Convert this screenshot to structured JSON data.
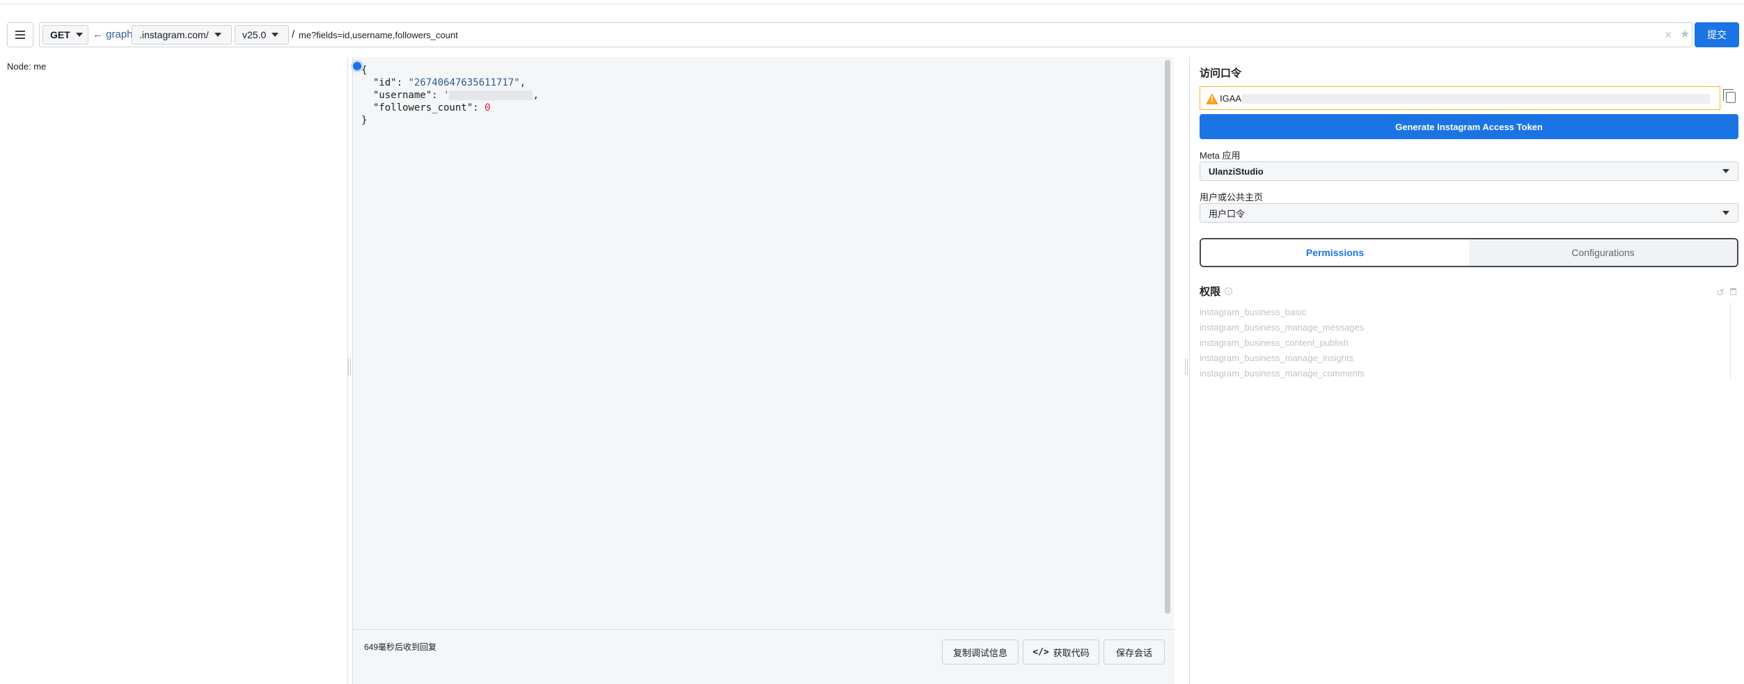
{
  "toolbar": {
    "method": "GET",
    "graph_link": "← graph.",
    "domain": ".instagram.com/",
    "version": "v25.0",
    "slash": "/",
    "path": "me?fields=id,username,followers_count",
    "clear_label": "×",
    "star_label": "★",
    "submit_label": "提交"
  },
  "left": {
    "node_label": "Node: me"
  },
  "response": {
    "open_brace": "{",
    "id_key": "\"id\"",
    "id_value": "\"26740647635611717\"",
    "username_key": "\"username\"",
    "username_value_start": "'",
    "followers_key": "\"followers_count\"",
    "followers_value": "0",
    "close_brace": "}"
  },
  "footer": {
    "status": "649毫秒后收到回复",
    "copy_debug_label": "复制调试信息",
    "get_code_glyph": "</>",
    "get_code_label": "获取代码",
    "save_session_label": "保存会话"
  },
  "right": {
    "access_token_title": "访问口令",
    "token_prefix": "IGAA",
    "generate_label": "Generate Instagram Access Token",
    "meta_app_label": "Meta 应用",
    "meta_app_value": "UlanziStudio",
    "user_page_label": "用户或公共主页",
    "user_page_value": "用户口令",
    "tabs": [
      "Permissions",
      "Configurations"
    ],
    "permissions_title": "权限",
    "permissions": [
      "instagram_business_basic",
      "instagram_business_manage_messages",
      "instagram_business_content_publish",
      "instagram_business_manage_insights",
      "instagram_business_manage_comments"
    ]
  },
  "colors": {
    "accent": "#1b74e4",
    "warning": "#f7b928",
    "json_string": "#2c5b93",
    "json_number": "#e41e3f"
  }
}
